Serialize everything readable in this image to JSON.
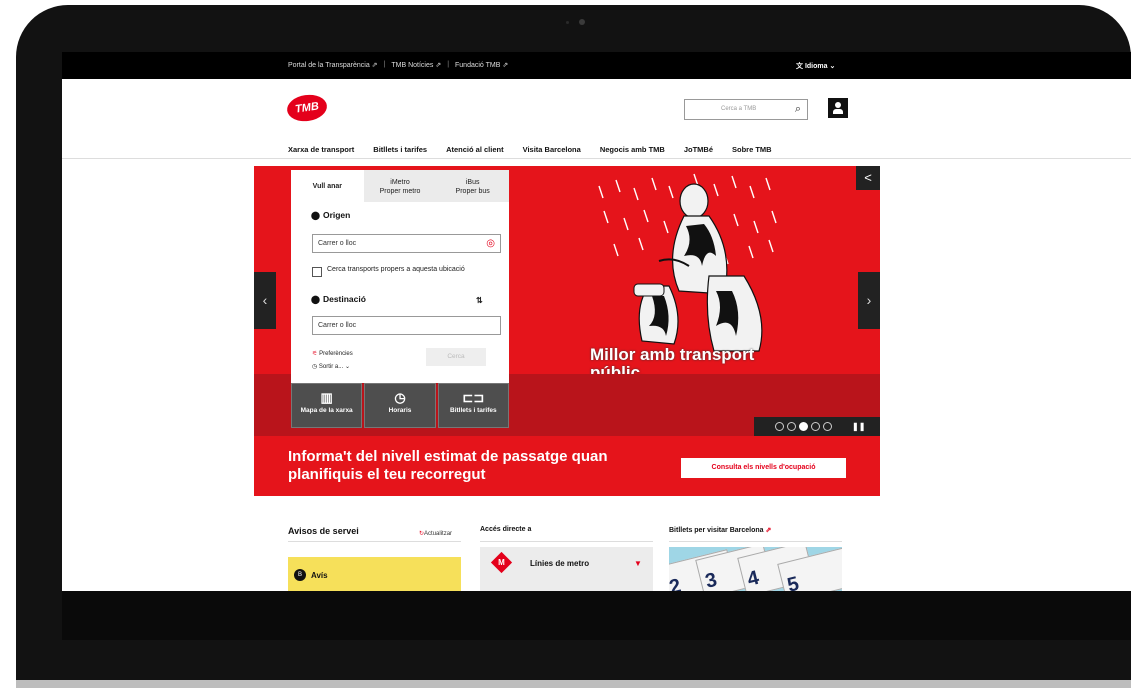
{
  "topbar": {
    "links": [
      "Portal de la Transparència",
      "TMB Notícies",
      "Fundació TMB"
    ],
    "language": "Idioma"
  },
  "header": {
    "logo": "TMB",
    "search_placeholder": "Cerca a TMB",
    "nav": [
      "Xarxa de transport",
      "Bitllets i tarifes",
      "Atenció al client",
      "Visita Barcelona",
      "Negocis amb TMB",
      "JoTMBé",
      "Sobre TMB"
    ]
  },
  "planner": {
    "tabs": [
      {
        "line1": "Vull anar",
        "line2": ""
      },
      {
        "line1": "iMetro",
        "line2": "Proper metro"
      },
      {
        "line1": "iBus",
        "line2": "Proper bus"
      }
    ],
    "origin_label": "Origen",
    "origin_placeholder": "Carrer o lloc",
    "nearby_checkbox": "Cerca transports propers a aquesta ubicació",
    "destination_label": "Destinació",
    "destination_placeholder": "Carrer o lloc",
    "preferences": "Preferències",
    "depart": "Sortir a...",
    "search_button": "Cerca"
  },
  "quick_links": [
    {
      "icon": "map-icon",
      "label": "Mapa de la xarxa"
    },
    {
      "icon": "clock-icon",
      "label": "Horaris"
    },
    {
      "icon": "ticket-icon",
      "label": "Bitllets i tarifes"
    }
  ],
  "hero": {
    "headline": "Millor amb transport públic.",
    "carousel_active": 3,
    "carousel_total": 5,
    "banner_text": "Informa't del nivell estimat de passatge quan planifiquis el teu recorregut",
    "banner_cta": "Consulta els nivells d'ocupació"
  },
  "sections": {
    "service": {
      "title": "Avisos de servei",
      "refresh": "Actualitzar",
      "alert": "Avís"
    },
    "direct": {
      "title": "Accés directe a",
      "item": "Línies de metro"
    },
    "tickets": {
      "title": "Bitllets per visitar Barcelona"
    }
  }
}
